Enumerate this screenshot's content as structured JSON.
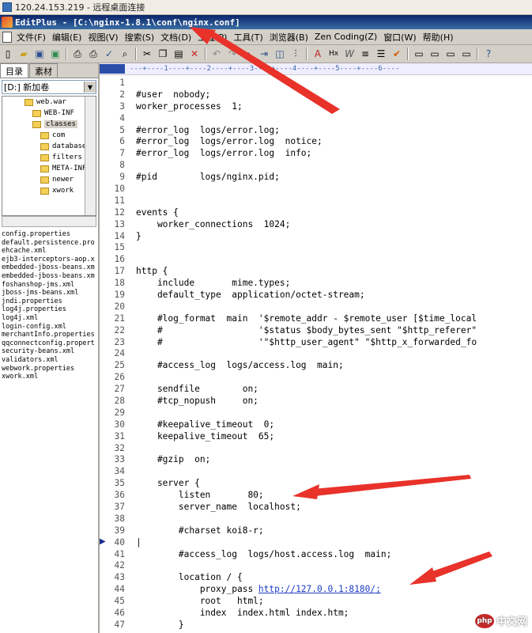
{
  "remote_window": {
    "title": "120.24.153.219 - 远程桌面连接"
  },
  "app": {
    "title": "EditPlus - [C:\\nginx-1.8.1\\conf\\nginx.conf]"
  },
  "menu": [
    {
      "label": "文件(F)"
    },
    {
      "label": "编辑(E)"
    },
    {
      "label": "视图(V)"
    },
    {
      "label": "搜索(S)"
    },
    {
      "label": "文档(D)"
    },
    {
      "label": "工程(P)"
    },
    {
      "label": "工具(T)"
    },
    {
      "label": "浏览器(B)"
    },
    {
      "label": "Zen Coding(Z)"
    },
    {
      "label": "窗口(W)"
    },
    {
      "label": "帮助(H)"
    }
  ],
  "toolbar": {
    "icons": [
      "new-file-icon",
      "open-folder-icon",
      "save-icon",
      "save-all-icon",
      "print-preview-icon",
      "print-icon",
      "spellcheck-icon",
      "find-icon",
      "cut-icon",
      "copy-icon",
      "paste-icon",
      "delete-icon",
      "undo-icon",
      "redo-icon",
      "search-replace-icon",
      "goto-icon",
      "browser-icon",
      "columns-icon",
      "font-icon",
      "hex-icon",
      "italic-icon",
      "word-wrap-icon",
      "line-numbers-icon",
      "check-icon",
      "view1-icon",
      "view2-icon",
      "view3-icon",
      "view4-icon",
      "help-icon"
    ],
    "labels": [
      "A",
      "Hx",
      "W"
    ]
  },
  "sidebar": {
    "tabs": [
      {
        "label": "目录"
      },
      {
        "label": "素材"
      }
    ],
    "drive": "[D:] 新加卷",
    "tree": [
      {
        "label": "web.war",
        "indent": 2
      },
      {
        "label": "WEB-INF",
        "indent": 3
      },
      {
        "label": "classes",
        "indent": 3,
        "selected": true
      },
      {
        "label": "com",
        "indent": 4
      },
      {
        "label": "database",
        "indent": 4
      },
      {
        "label": "filters",
        "indent": 4
      },
      {
        "label": "META-INF",
        "indent": 4
      },
      {
        "label": "newer",
        "indent": 4
      },
      {
        "label": "xwork",
        "indent": 4
      }
    ],
    "files": [
      "config.properties",
      "default.persistence.pro",
      "ehcache.xml",
      "ejb3-interceptors-aop.x",
      "embedded-jboss-beans.xm",
      "embedded-jboss-beans.xm",
      "foshanshop-jms.xml",
      "jboss-jms-beans.xml",
      "jndi.properties",
      "log4j.properties",
      "log4j.xml",
      "login-config.xml",
      "merchantInfo.properties",
      "qqconnectconfig.propert",
      "security-beans.xml",
      "validators.xml",
      "webwork.properties",
      "xwork.xml"
    ]
  },
  "editor": {
    "ruler": "---+----1----+----2----+----3----+----4----+----5----+----6----",
    "lines": [
      {
        "n": "1",
        "t": ""
      },
      {
        "n": "2",
        "t": "#user  nobody;"
      },
      {
        "n": "3",
        "t": "worker_processes  1;"
      },
      {
        "n": "4",
        "t": ""
      },
      {
        "n": "5",
        "t": "#error_log  logs/error.log;"
      },
      {
        "n": "6",
        "t": "#error_log  logs/error.log  notice;"
      },
      {
        "n": "7",
        "t": "#error_log  logs/error.log  info;"
      },
      {
        "n": "8",
        "t": ""
      },
      {
        "n": "9",
        "t": "#pid        logs/nginx.pid;"
      },
      {
        "n": "10",
        "t": ""
      },
      {
        "n": "11",
        "t": ""
      },
      {
        "n": "12",
        "t": "events {"
      },
      {
        "n": "13",
        "t": "    worker_connections  1024;"
      },
      {
        "n": "14",
        "t": "}"
      },
      {
        "n": "15",
        "t": ""
      },
      {
        "n": "16",
        "t": ""
      },
      {
        "n": "17",
        "t": "http {"
      },
      {
        "n": "18",
        "t": "    include       mime.types;"
      },
      {
        "n": "19",
        "t": "    default_type  application/octet-stream;"
      },
      {
        "n": "20",
        "t": ""
      },
      {
        "n": "21",
        "t": "    #log_format  main  '$remote_addr - $remote_user [$time_local"
      },
      {
        "n": "22",
        "t": "    #                  '$status $body_bytes_sent \"$http_referer\""
      },
      {
        "n": "23",
        "t": "    #                  '\"$http_user_agent\" \"$http_x_forwarded_fo"
      },
      {
        "n": "24",
        "t": ""
      },
      {
        "n": "25",
        "t": "    #access_log  logs/access.log  main;"
      },
      {
        "n": "26",
        "t": ""
      },
      {
        "n": "27",
        "t": "    sendfile        on;"
      },
      {
        "n": "28",
        "t": "    #tcp_nopush     on;"
      },
      {
        "n": "29",
        "t": ""
      },
      {
        "n": "30",
        "t": "    #keepalive_timeout  0;"
      },
      {
        "n": "31",
        "t": "    keepalive_timeout  65;"
      },
      {
        "n": "32",
        "t": ""
      },
      {
        "n": "33",
        "t": "    #gzip  on;"
      },
      {
        "n": "34",
        "t": ""
      },
      {
        "n": "35",
        "t": "    server {"
      },
      {
        "n": "36",
        "t": "        listen       80;"
      },
      {
        "n": "37",
        "t": "        server_name  localhost;"
      },
      {
        "n": "38",
        "t": ""
      },
      {
        "n": "39",
        "t": "        #charset koi8-r;"
      },
      {
        "n": "40",
        "t": "|"
      },
      {
        "n": "41",
        "t": "        #access_log  logs/host.access.log  main;"
      },
      {
        "n": "42",
        "t": ""
      },
      {
        "n": "43",
        "t": "        location / {"
      },
      {
        "n": "44",
        "t": "            proxy_pass ",
        "url": "http://127.0.0.1:8180/;"
      },
      {
        "n": "45",
        "t": "            root   html;"
      },
      {
        "n": "46",
        "t": "            index  index.html index.htm;"
      },
      {
        "n": "47",
        "t": "        }"
      }
    ]
  },
  "watermark": {
    "logo": "php",
    "text": "中文网"
  },
  "colors": {
    "arrow": "#e8322a",
    "title_bar": "#0a246a",
    "link": "#1c3cc5"
  }
}
